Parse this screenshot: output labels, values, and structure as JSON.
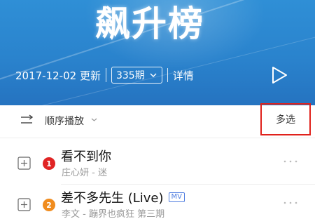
{
  "banner": {
    "title": "飙升榜",
    "date": "2017-12-02 更新",
    "issue": "335期",
    "details": "详情"
  },
  "toolbar": {
    "order_label": "顺序播放",
    "multi_select_label": "多选"
  },
  "songs": [
    {
      "rank": "1",
      "title": "看不到你",
      "artist_album": "庄心妍 - 迷",
      "rank_color": "#e02424"
    },
    {
      "rank": "2",
      "title": "差不多先生 (Live)",
      "mv": "MV",
      "artist_album": "李文 - 蹦界也疯狂 第三期",
      "rank_color": "#f08c1e"
    }
  ],
  "colors": {
    "banner": "#2a83cd",
    "highlight_box": "#e0211b",
    "mv_badge": "#4f7de0"
  },
  "icons": [
    "play-icon",
    "chevron-down-icon",
    "order-play-icon",
    "add-icon",
    "more-icon"
  ]
}
